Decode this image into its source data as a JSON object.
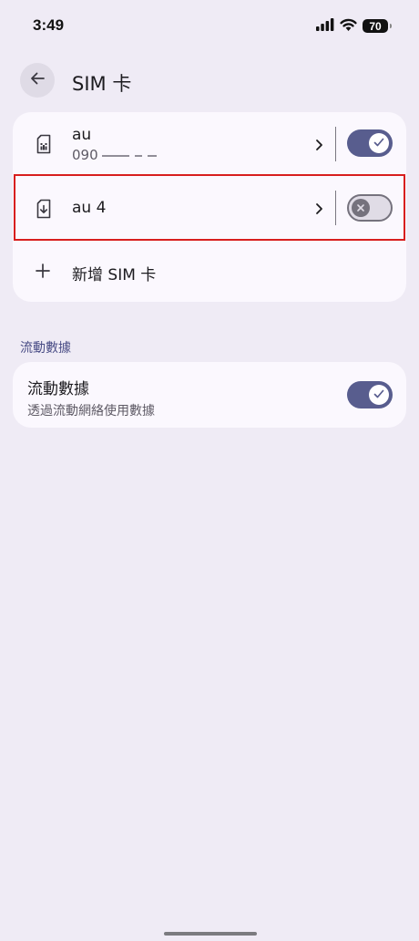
{
  "status_bar": {
    "time": "3:49",
    "battery": "70",
    "icons": [
      "signal-icon",
      "wifi-icon",
      "battery-icon"
    ]
  },
  "header": {
    "title": "SIM 卡",
    "back_icon": "arrow-left-icon"
  },
  "sim_list": {
    "items": [
      {
        "name": "au",
        "number": "090",
        "enabled": true,
        "icon": "sim-card-icon"
      },
      {
        "name": "au 4",
        "enabled": false,
        "icon": "esim-download-icon"
      }
    ],
    "add_label": "新增 SIM 卡",
    "add_icon": "plus-icon"
  },
  "mobile_data": {
    "section_label": "流動數據",
    "title": "流動數據",
    "subtitle": "透過流動網絡使用數據",
    "enabled": true
  },
  "colors": {
    "background": "#EFEBF5",
    "card": "#FBF8FE",
    "accent": "#585D8E",
    "highlight": "#D81E1E"
  }
}
